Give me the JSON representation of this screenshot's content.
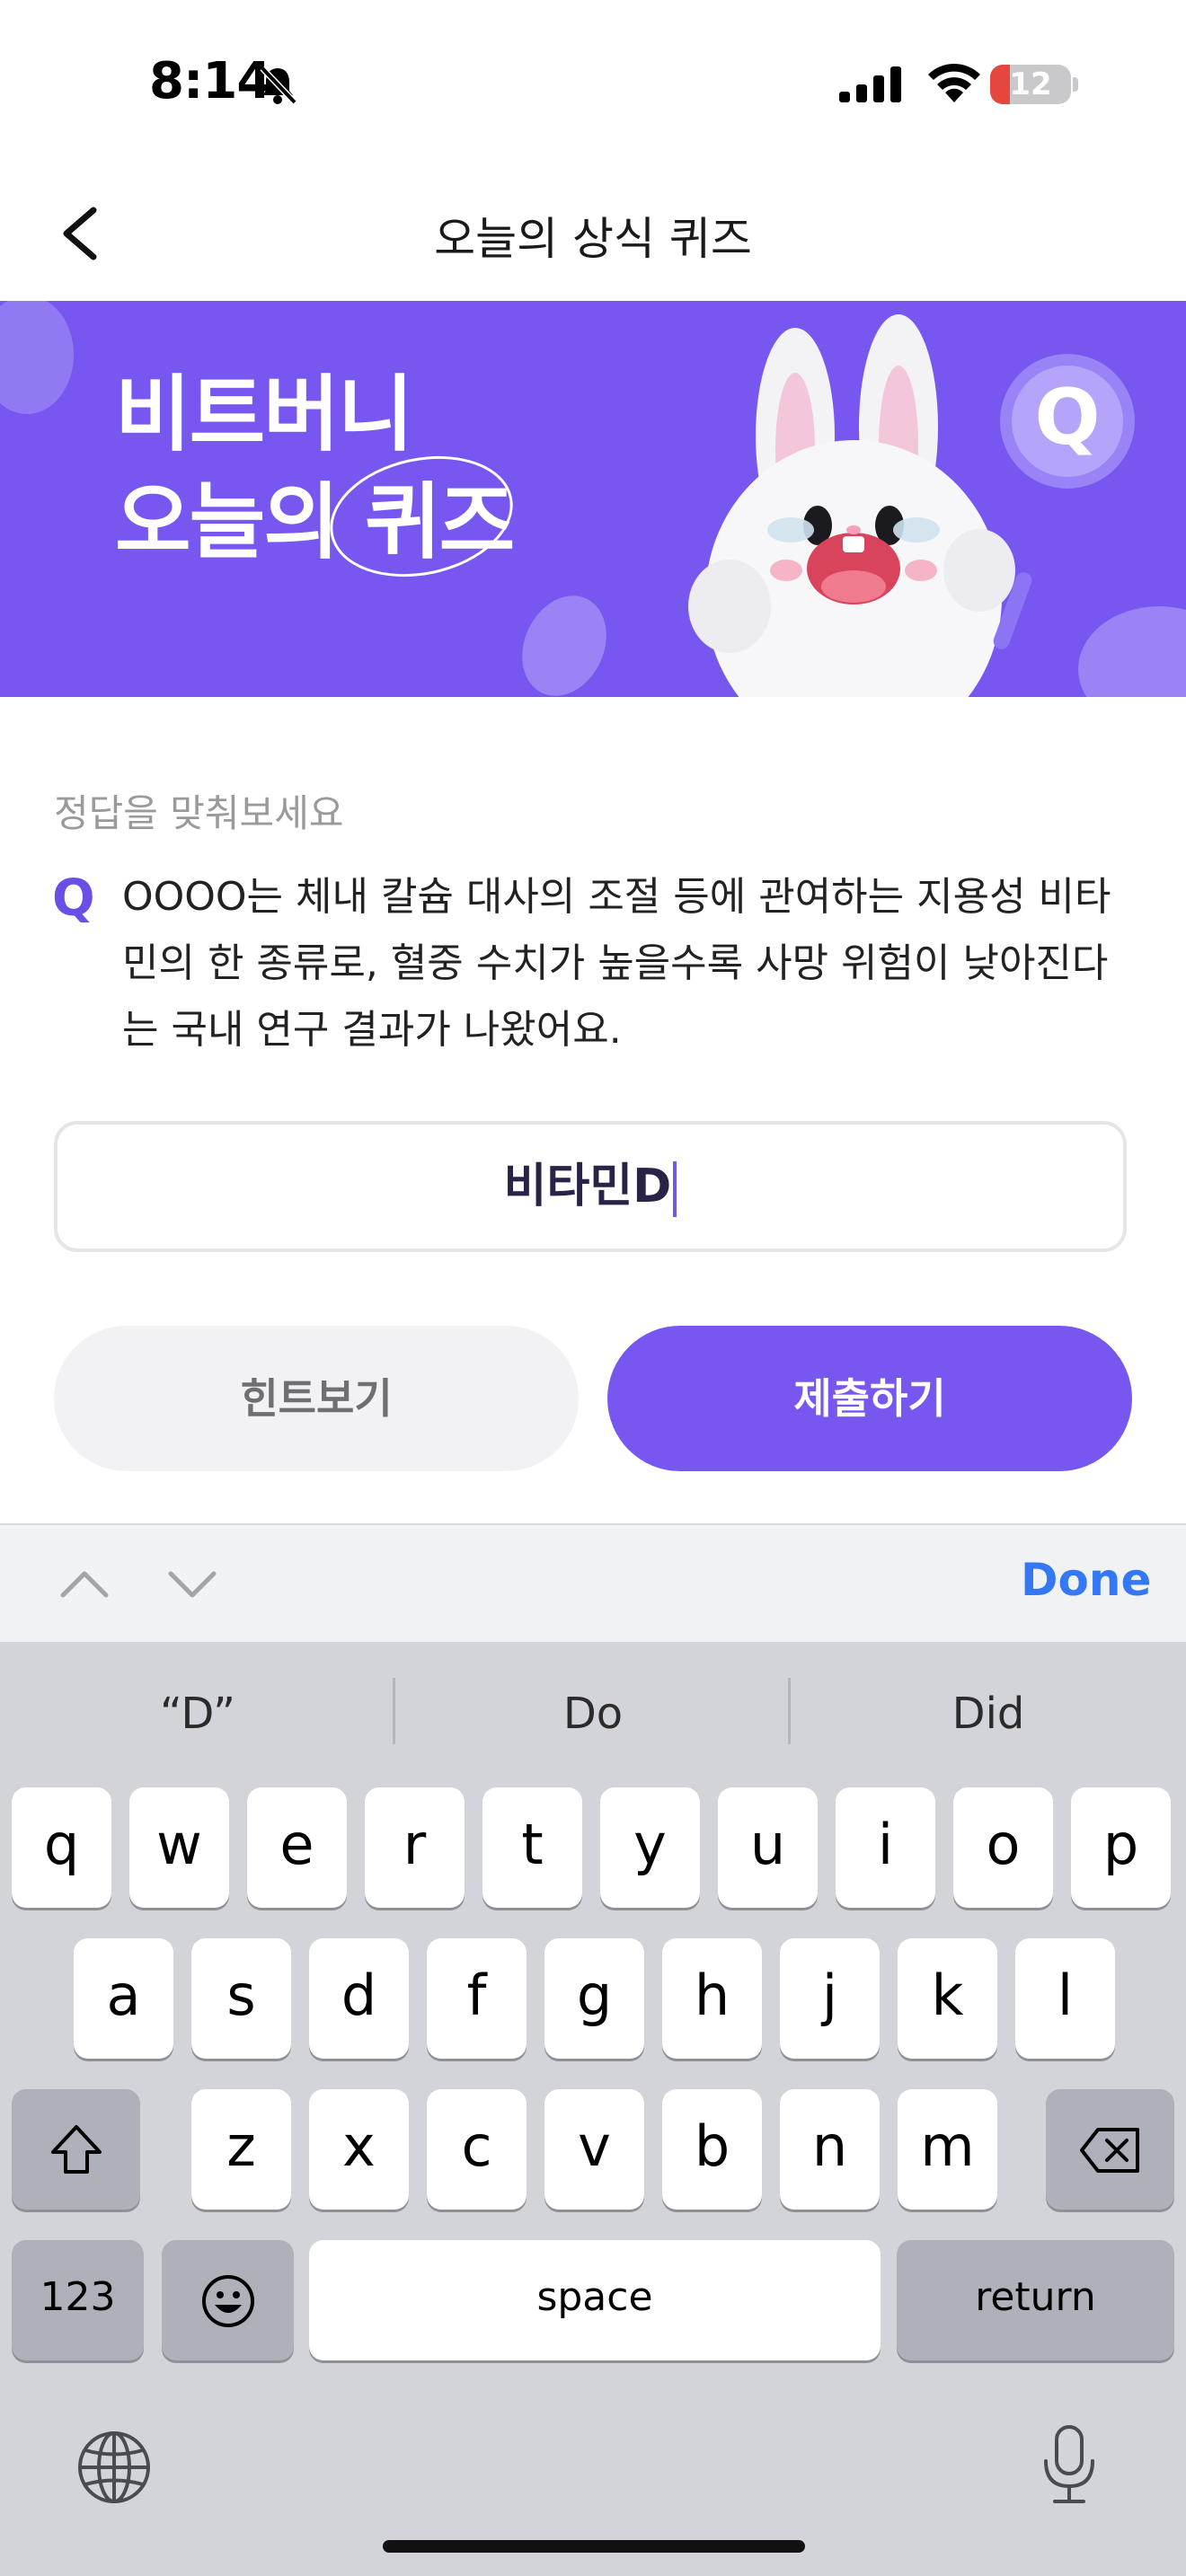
{
  "status_bar": {
    "time": "8:14",
    "battery": "12"
  },
  "header": {
    "title": "오늘의 상식 퀴즈"
  },
  "banner": {
    "line1": "비트버니",
    "line2_prefix": "오늘의 ",
    "line2_highlight": "퀴즈",
    "coin_letter": "Q"
  },
  "quiz": {
    "instruction": "정답을 맞춰보세요",
    "q_mark": "Q",
    "question_lines": [
      "OOOO는 체내 칼슘 대사의 조절 등에 관여하는 지용성 비타",
      "민의 한 종류로, 혈중 수치가 높을수록 사망 위험이 낮아진다",
      "는 국내 연구 결과가 나왔어요."
    ],
    "answer_value": "비타민D"
  },
  "buttons": {
    "hint": "힌트보기",
    "submit": "제출하기"
  },
  "keyboard": {
    "done": "Done",
    "suggestions": [
      "“D”",
      "Do",
      "Did"
    ],
    "row1": [
      "q",
      "w",
      "e",
      "r",
      "t",
      "y",
      "u",
      "i",
      "o",
      "p"
    ],
    "row2": [
      "a",
      "s",
      "d",
      "f",
      "g",
      "h",
      "j",
      "k",
      "l"
    ],
    "row3": [
      "z",
      "x",
      "c",
      "v",
      "b",
      "n",
      "m"
    ],
    "numbers": "123",
    "space": "space",
    "return": "return"
  }
}
